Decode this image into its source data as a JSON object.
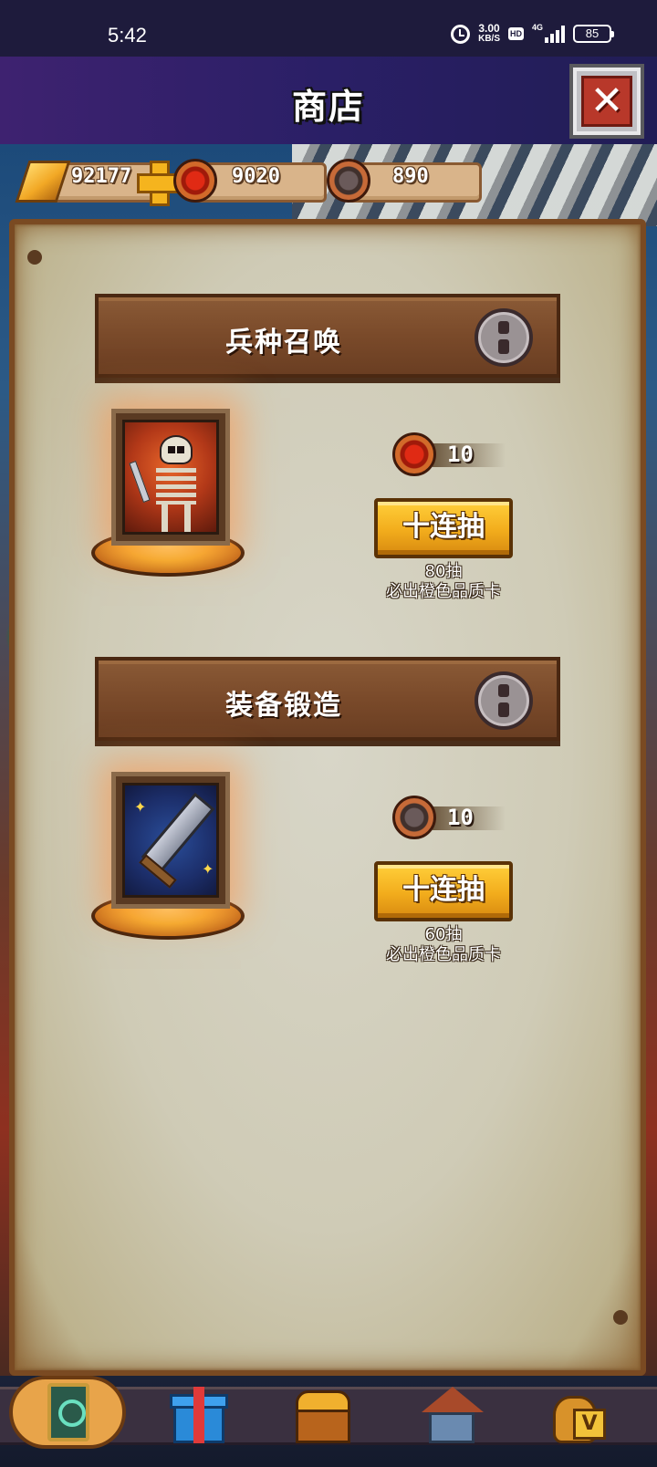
{
  "status_bar": {
    "time": "5:42",
    "net_speed_value": "3.00",
    "net_speed_unit": "KB/S",
    "hd_badge": "HD",
    "network_type": "4G",
    "battery_level": "85"
  },
  "header": {
    "title": "商店",
    "close_icon": "close-icon"
  },
  "currencies": {
    "gold": "92177",
    "red_token": "9020",
    "anvil_token": "890"
  },
  "sections": [
    {
      "title": "兵种召唤",
      "item_icon": "skeleton-warrior-card",
      "cost_icon": "red-token-icon",
      "cost": "10",
      "button_label": "十连抽",
      "pity_count": "80抽",
      "pity_text": "必出橙色品质卡"
    },
    {
      "title": "装备锻造",
      "item_icon": "sword-card",
      "cost_icon": "anvil-token-icon",
      "cost": "10",
      "button_label": "十连抽",
      "pity_count": "60抽",
      "pity_text": "必出橙色品质卡"
    }
  ],
  "bottom_nav": {
    "items": [
      {
        "icon": "card-icon",
        "active": true
      },
      {
        "icon": "gift-icon",
        "active": false
      },
      {
        "icon": "treasure-chest-icon",
        "active": false
      },
      {
        "icon": "building-icon",
        "active": false
      },
      {
        "icon": "money-bag-icon",
        "active": false
      }
    ]
  },
  "colors": {
    "title_bar": "#2a1f66",
    "parchment": "#cfcbb6",
    "wood": "#7a4a2a",
    "button_gold": "#f2ac1c"
  }
}
